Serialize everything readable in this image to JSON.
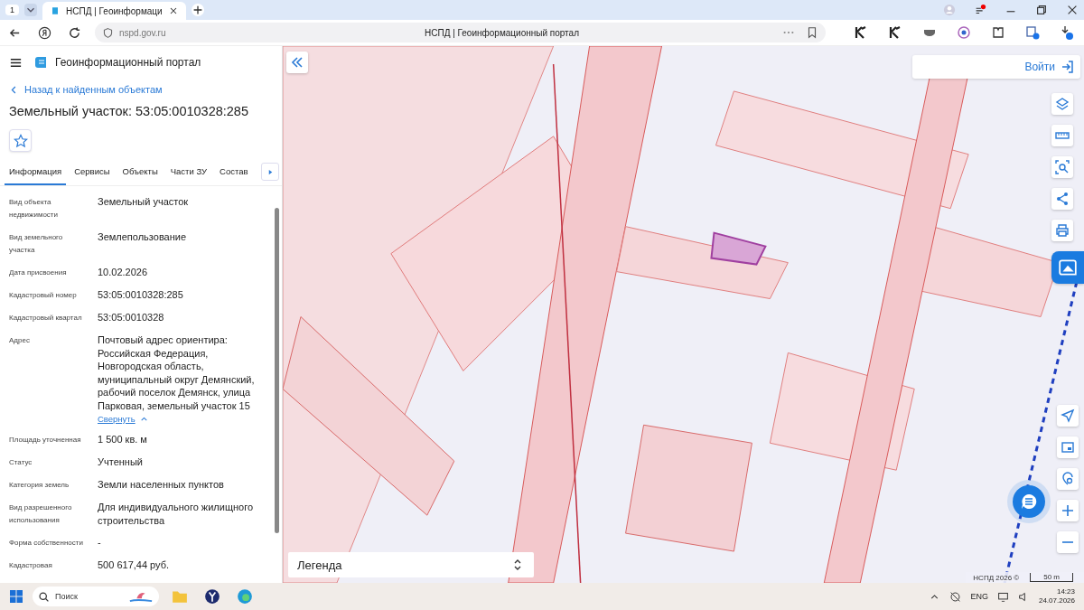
{
  "browser": {
    "tab_counter": "1",
    "tab_title": "НСПД | Геоинформаци",
    "url": "nspd.gov.ru",
    "page_title": "НСПД | Геоинформационный портал"
  },
  "app": {
    "title": "Геоинформационный портал",
    "back_link": "Назад к найденным объектам",
    "heading": "Земельный участок: 53:05:0010328:285"
  },
  "tabs": [
    {
      "label": "Информация",
      "selected": true
    },
    {
      "label": "Сервисы",
      "selected": false
    },
    {
      "label": "Объекты",
      "selected": false
    },
    {
      "label": "Части ЗУ",
      "selected": false
    },
    {
      "label": "Состав",
      "selected": false
    }
  ],
  "fields": [
    {
      "label": "Вид объекта недвижимости",
      "value": "Земельный участок"
    },
    {
      "label": "Вид земельного участка",
      "value": "Землепользование"
    },
    {
      "label": "Дата присвоения",
      "value": "10.02.2026"
    },
    {
      "label": "Кадастровый номер",
      "value": "53:05:0010328:285"
    },
    {
      "label": "Кадастровый квартал",
      "value": "53:05:0010328"
    },
    {
      "label": "Адрес",
      "value": "Почтовый адрес ориентира: Российская Федерация, Новгородская область, муниципальный округ Демянский, рабочий поселок Демянск, улица Парковая, земельный участок 15",
      "link": "Свернуть"
    },
    {
      "label": "Площадь уточненная",
      "value": "1 500 кв. м"
    },
    {
      "label": "Статус",
      "value": "Учтенный"
    },
    {
      "label": "Категория земель",
      "value": "Земли населенных пунктов"
    },
    {
      "label": "Вид разрешенного использования",
      "value": "Для индивидуального жилищного строительства"
    },
    {
      "label": "Форма собственности",
      "value": "-"
    },
    {
      "label": "Кадастровая",
      "value": "500 617,44 руб."
    }
  ],
  "map": {
    "login": "Войти",
    "legend": "Легенда",
    "attribution": "НСПД 2026 ©",
    "scale": "50 m"
  },
  "taskbar": {
    "search_placeholder": "Поиск",
    "language": "ENG",
    "time": "14:23",
    "date": "24.07.2026"
  }
}
